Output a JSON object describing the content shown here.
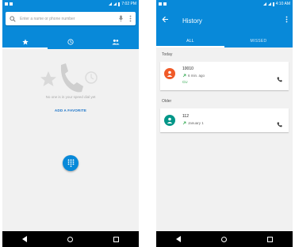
{
  "left": {
    "status_time": "7:02 PM",
    "search": {
      "placeholder": "Enter a name or phone number"
    },
    "tabs": [
      "speed-dial",
      "recents",
      "contacts"
    ],
    "empty_text": "No one is in your speed dial yet",
    "add_favorite_label": "ADD A FAVORITE"
  },
  "right": {
    "status_time": "4:10 AM",
    "title": "History",
    "tabs": [
      "ALL",
      "MISSED"
    ],
    "sections": [
      {
        "label": "Today",
        "calls": [
          {
            "number": "10010",
            "time": "6 min. ago",
            "sim": "CU",
            "avatar_color": "#f05a28"
          }
        ]
      },
      {
        "label": "Older",
        "calls": [
          {
            "number": "112",
            "time": "January 1",
            "avatar_color": "#009688"
          }
        ]
      }
    ]
  },
  "colors": {
    "primary": "#0889d9",
    "background": "#f1f1f1",
    "accent_green": "#2aa54a"
  }
}
